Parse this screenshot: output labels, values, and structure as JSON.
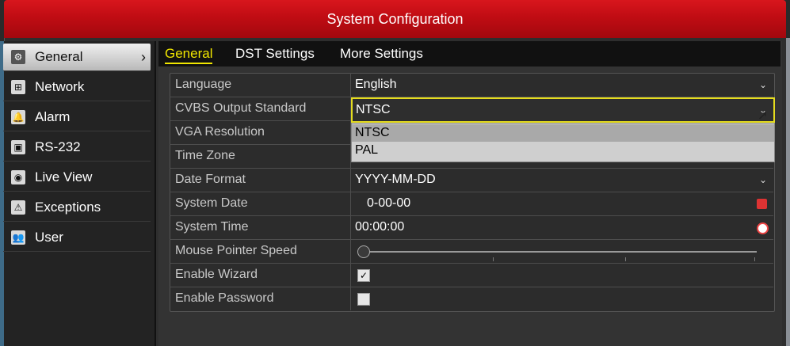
{
  "window": {
    "title": "System Configuration"
  },
  "sidebar": {
    "items": [
      {
        "label": "General",
        "icon": "gear-icon",
        "glyph": "⚙",
        "active": true
      },
      {
        "label": "Network",
        "icon": "network-icon",
        "glyph": "⊞"
      },
      {
        "label": "Alarm",
        "icon": "alarm-bell-icon",
        "glyph": "🔔"
      },
      {
        "label": "RS-232",
        "icon": "serial-port-icon",
        "glyph": "▣"
      },
      {
        "label": "Live View",
        "icon": "eye-icon",
        "glyph": "◉"
      },
      {
        "label": "Exceptions",
        "icon": "warning-icon",
        "glyph": "⚠"
      },
      {
        "label": "User",
        "icon": "users-icon",
        "glyph": "👥"
      }
    ]
  },
  "tabs": [
    {
      "label": "General",
      "active": true
    },
    {
      "label": "DST Settings"
    },
    {
      "label": "More Settings"
    }
  ],
  "settings": {
    "language": {
      "label": "Language",
      "value": "English"
    },
    "cvbs": {
      "label": "CVBS Output Standard",
      "value": "NTSC",
      "options": [
        "NTSC",
        "PAL"
      ]
    },
    "vga": {
      "label": "VGA Resolution"
    },
    "timezone": {
      "label": "Time Zone"
    },
    "date_format": {
      "label": "Date Format",
      "value": "YYYY-MM-DD"
    },
    "system_date": {
      "label": "System Date",
      "value": "0-00-00"
    },
    "system_time": {
      "label": "System Time",
      "value": "00:00:00"
    },
    "mouse_speed": {
      "label": "Mouse Pointer Speed",
      "level": 0
    },
    "enable_wizard": {
      "label": "Enable Wizard",
      "checked": true,
      "mark": "✓"
    },
    "enable_password": {
      "label": "Enable Password",
      "checked": false
    }
  },
  "colors": {
    "title_red": "#c00c13",
    "focus_yellow": "#e5dc1e",
    "tab_active": "#f1e600"
  }
}
